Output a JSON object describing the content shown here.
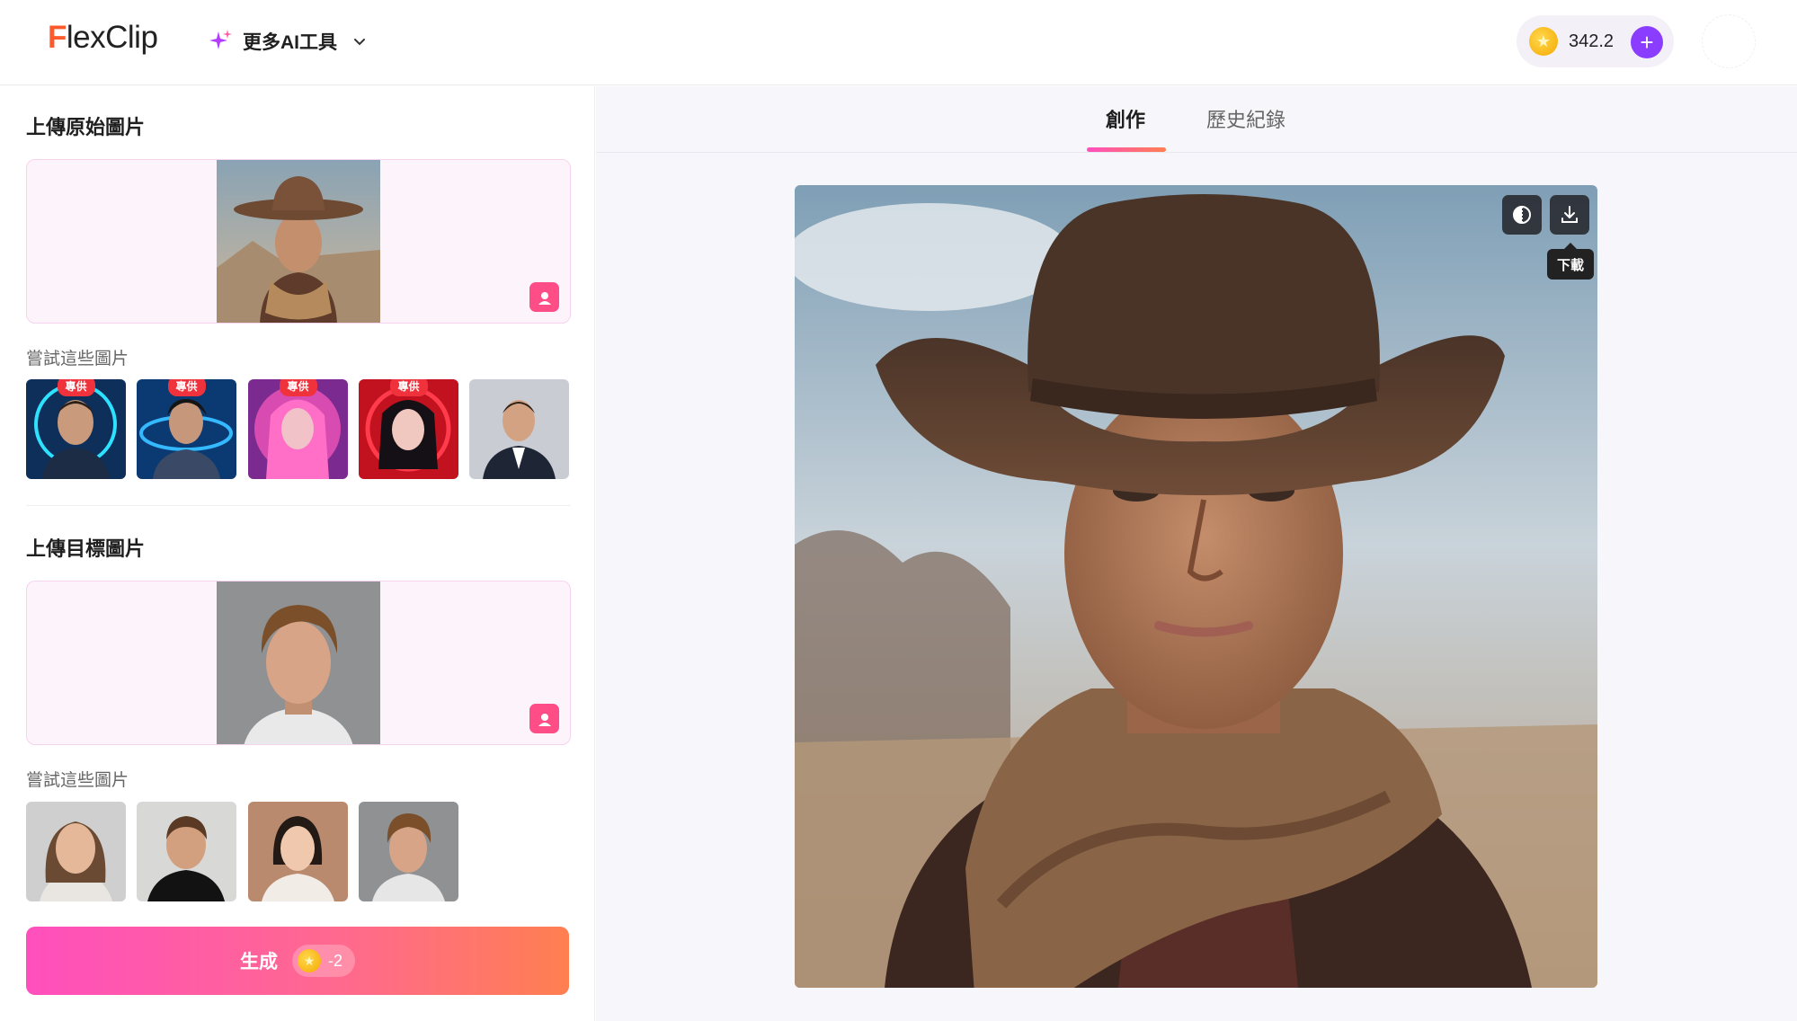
{
  "header": {
    "logo_f": "F",
    "logo_rest": "lexClip",
    "ai_tools_label": "更多AI工具",
    "credits": "342.2"
  },
  "left": {
    "source_title": "上傳原始圖片",
    "source_try_label": "嘗試這些圖片",
    "source_samples": [
      {
        "badge": "專供"
      },
      {
        "badge": "專供"
      },
      {
        "badge": "專供"
      },
      {
        "badge": "專供"
      },
      {
        "badge": ""
      }
    ],
    "target_title": "上傳目標圖片",
    "target_try_label": "嘗試這些圖片",
    "generate_label": "生成",
    "generate_cost": "-2"
  },
  "right": {
    "tabs": [
      {
        "label": "創作"
      },
      {
        "label": "歷史紀錄"
      }
    ],
    "download_tooltip": "下載"
  },
  "colors": {
    "brand": "#ff5a2b",
    "accent_purple": "#8b3dff",
    "generate_gradient": [
      "#ff4fbd",
      "#ff7f50"
    ]
  }
}
